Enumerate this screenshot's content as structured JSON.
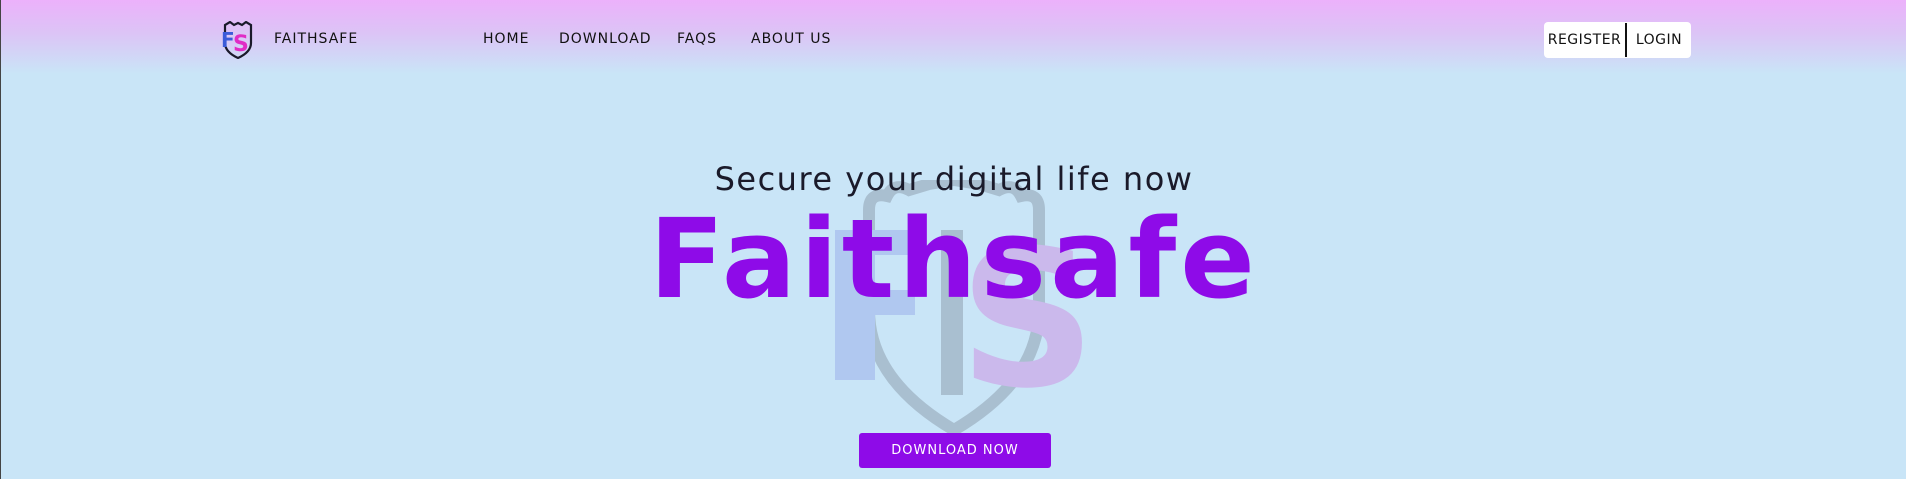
{
  "header": {
    "brand": "FAITHSAFE",
    "logo_icon": "faithsafe-shield-logo",
    "nav": [
      {
        "label": "HOME"
      },
      {
        "label": "DOWNLOAD"
      },
      {
        "label": "FAQS"
      },
      {
        "label": "ABOUT US"
      }
    ],
    "auth": {
      "register": "REGISTER",
      "login": "LOGIN"
    }
  },
  "hero": {
    "tagline": "Secure your digital life now",
    "title": "Faithsafe",
    "cta": "DOWNLOAD NOW",
    "watermark_icon": "faithsafe-shield-watermark"
  },
  "colors": {
    "background": "#c9e5f7",
    "header_gradient_top": "#ecb1fb",
    "accent": "#8e0be8",
    "logo_blue": "#3b5bd9",
    "logo_pink": "#e02cc6"
  }
}
